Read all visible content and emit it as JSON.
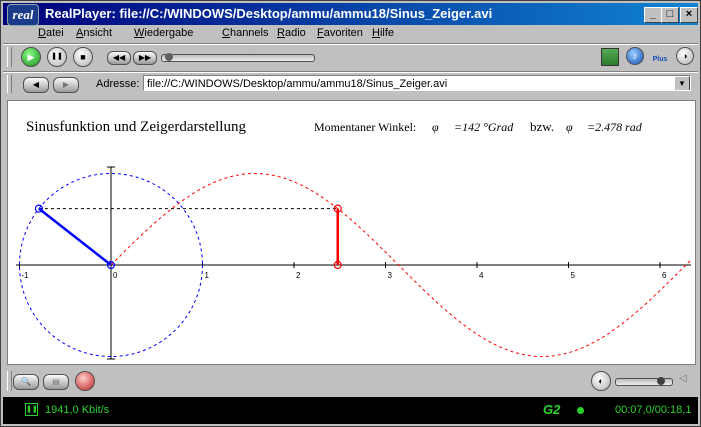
{
  "window": {
    "logo_text": "real",
    "title": "RealPlayer: file://C:/WINDOWS/Desktop/ammu/ammu18/Sinus_Zeiger.avi",
    "min_glyph": "_",
    "max_glyph": "□",
    "close_glyph": "×"
  },
  "menu": {
    "items": [
      {
        "label": "Datei",
        "accel": "D"
      },
      {
        "label": "Ansicht",
        "accel": "A"
      },
      {
        "label": "Wiedergabe",
        "accel": "W"
      },
      {
        "label": "Channels",
        "accel": "C"
      },
      {
        "label": "Radio",
        "accel": "R"
      },
      {
        "label": "Favoriten",
        "accel": "F"
      },
      {
        "label": "Hilfe",
        "accel": "H"
      }
    ]
  },
  "transport": {
    "play_glyph": "▶",
    "pause_glyph": "❚❚",
    "stop_glyph": "■",
    "rewind_glyph": "◀◀",
    "forward_glyph": "▶▶",
    "position_fraction": 0.02,
    "plus_label": "Plus"
  },
  "address": {
    "label": "Adresse:",
    "value": "file://C:/WINDOWS/Desktop/ammu/ammu18/Sinus_Zeiger.avi",
    "dropdown_glyph": "▼"
  },
  "video": {
    "title": "Sinusfunktion und Zeigerdarstellung",
    "angle_label": "Momentaner Winkel:",
    "phi_symbol": "φ",
    "deg_value": "=142 °Grad",
    "bzw": "bzw.",
    "rad_value": "=2.478 rad",
    "angle_rad": 2.478,
    "axis": {
      "x_ticks": [
        "-1",
        "0",
        "1",
        "2",
        "3",
        "4",
        "5",
        "6"
      ],
      "x_min": -1,
      "x_max": 6.3
    },
    "colors": {
      "circle": "#0000ff",
      "pointer": "#0000ff",
      "sine": "#ff0000",
      "marker": "#ff0000",
      "guide": "#000000"
    }
  },
  "bottom": {
    "volume_fraction": 0.85
  },
  "status": {
    "bitrate": "1941,0 Kbit/s",
    "brand": "G2",
    "time": "00:07,0/00:18,1",
    "color": "#2ad12a"
  }
}
